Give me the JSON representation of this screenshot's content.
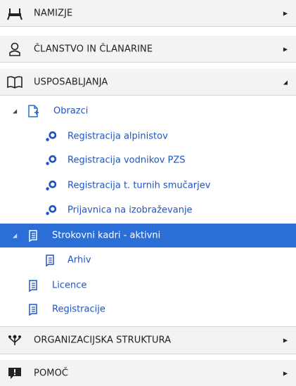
{
  "sections": {
    "namizje": "NAMIZJE",
    "clanstvo": "ČLANSTVO IN ČLANARINE",
    "usposabljanja": "USPOSABLJANJA",
    "organizacija": "ORGANIZACIJSKA STRUKTURA",
    "pomoc": "POMOČ"
  },
  "tree": {
    "obrazci": "Obrazci",
    "forms": [
      "Registracija alpinistov",
      "Registracija vodnikov PZS",
      "Registracija t. turnih smučarjev",
      "Prijavnica na izobraževanje"
    ],
    "strokovni": "Strokovni kadri - aktivni",
    "arhiv": "Arhiv",
    "licence": "Licence",
    "registracije": "Registracije"
  },
  "colors": {
    "accent": "#2b6fd6",
    "link": "#1f55c0",
    "header_bg": "#f3f3f3"
  }
}
